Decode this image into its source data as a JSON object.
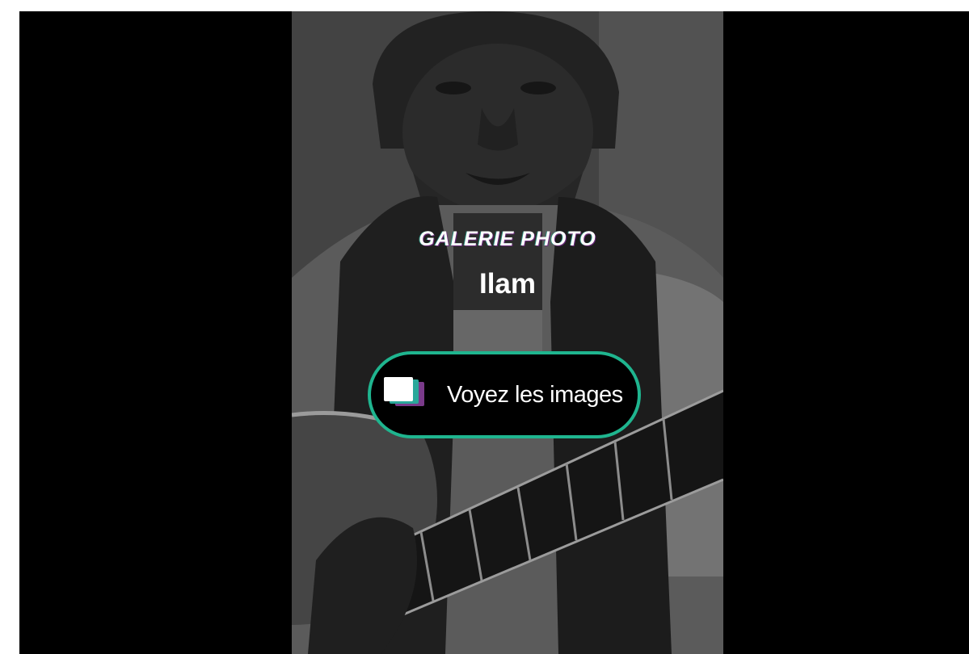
{
  "gallery": {
    "kicker": "GALERIE PHOTO",
    "title": "Ilam",
    "button": {
      "label": "Voyez les images",
      "icon": "image-stack-icon",
      "border_color": "#1fb58f"
    }
  },
  "colors": {
    "background": "#000000",
    "accent": "#1fb58f"
  }
}
